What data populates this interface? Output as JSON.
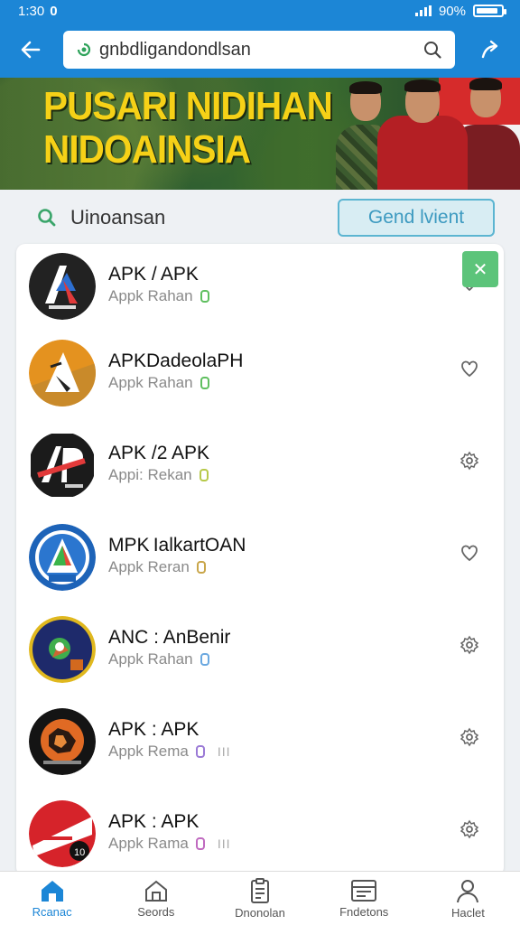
{
  "status_bar": {
    "time": "1:30",
    "notification": "0",
    "battery": "90%",
    "battery_level": 0.9
  },
  "app_bar": {
    "url": "gnbdligandondlsan",
    "back_icon": "arrow-left-icon",
    "search_icon": "search-icon",
    "share_icon": "share-icon"
  },
  "banner": {
    "title_line1": "PUSARI NIDIHAN",
    "title_line2": "NIDOAINSIA"
  },
  "search": {
    "text": "Uinoansan",
    "button_label": "Gend lvient"
  },
  "apps": [
    {
      "name": "APK / APK",
      "subtitle": "Appk Rahan",
      "tag_color": "#5fbf5f",
      "extra": ""
    },
    {
      "name": "APKDadeolaPH",
      "subtitle": "Appk Rahan",
      "tag_color": "#5fbf5f",
      "extra": ""
    },
    {
      "name": "APK /2 APK",
      "subtitle": "Appi: Rekan",
      "tag_color": "#b7c94a",
      "extra": ""
    },
    {
      "name": "MPK IalkartOAN",
      "subtitle": "Appk Reran",
      "tag_color": "#c9a64a",
      "extra": ""
    },
    {
      "name": "ANC : AnBenir",
      "subtitle": "Appk Rahan",
      "tag_color": "#6aa8e0",
      "extra": ""
    },
    {
      "name": "APK : APK",
      "subtitle": "Appk Rema",
      "tag_color": "#9b7ad6",
      "extra": "III"
    },
    {
      "name": "APK : APK",
      "subtitle": "Appk Rama",
      "tag_color": "#c06ac0",
      "extra": "III"
    }
  ],
  "nav": [
    {
      "label": "Rcanac",
      "icon": "home-icon",
      "active": true
    },
    {
      "label": "Seords",
      "icon": "house-outline-icon",
      "active": false
    },
    {
      "label": "Dnonolan",
      "icon": "clipboard-icon",
      "active": false
    },
    {
      "label": "Fndetons",
      "icon": "document-list-icon",
      "active": false
    },
    {
      "label": "Haclet",
      "icon": "person-icon",
      "active": false
    }
  ],
  "colors": {
    "primary": "#1c86d6",
    "banner_title": "#f6d117",
    "accent_button": "#3d9ac0"
  }
}
